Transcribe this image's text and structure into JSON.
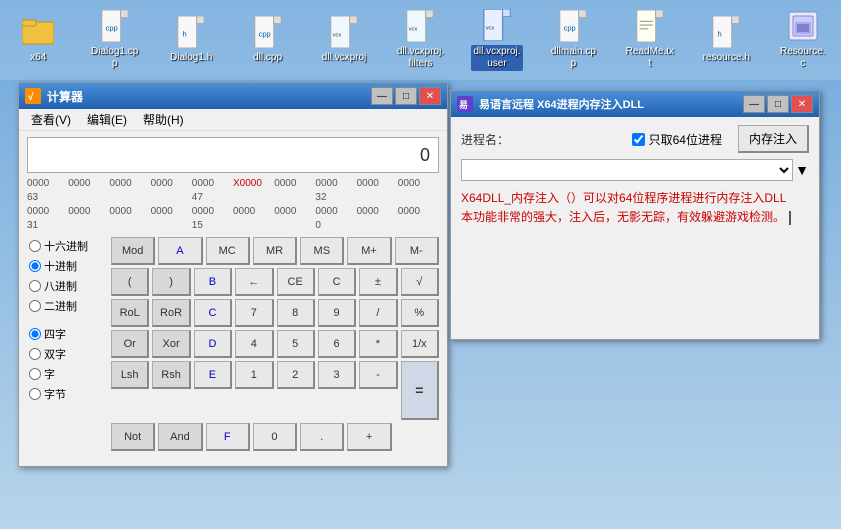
{
  "desktop": {
    "background": "linear-gradient(180deg, #6fa8dc 0%, #b8d4ea 100%)"
  },
  "fileBar": {
    "files": [
      {
        "id": "x64",
        "label": "x64",
        "type": "folder",
        "active": false
      },
      {
        "id": "dialog1cpp",
        "label": "Dialog1.cp\np",
        "type": "cpp",
        "active": false
      },
      {
        "id": "dialog1h",
        "label": "Dialog1.h",
        "type": "h",
        "active": false
      },
      {
        "id": "dllcpp",
        "label": "dll.cpp",
        "type": "cpp",
        "active": false
      },
      {
        "id": "dllvcxproj",
        "label": "dll.vcxproj",
        "type": "vcxproj",
        "active": false
      },
      {
        "id": "dllvcxprojfilters",
        "label": "dll.vcxproj.\nfilters",
        "type": "vcxproj",
        "active": false
      },
      {
        "id": "dllvcxprojuser",
        "label": "dll.vcxproj.\nuser",
        "type": "vcxproj",
        "active": true
      },
      {
        "id": "dllmaincpp",
        "label": "dllmain.cp\np",
        "type": "cpp",
        "active": false
      },
      {
        "id": "readmetxt",
        "label": "ReadMe.tx\nt",
        "type": "txt",
        "active": false
      },
      {
        "id": "resourceh",
        "label": "resource.h",
        "type": "h",
        "active": false
      },
      {
        "id": "resourcerc",
        "label": "Resource.\nc",
        "type": "rc",
        "active": false
      }
    ]
  },
  "calcWindow": {
    "title": "计算器",
    "menuItems": [
      "查看(V)",
      "编辑(E)",
      "帮助(H)"
    ],
    "display": "0",
    "memoryRows": [
      [
        "0000",
        "0000",
        "0000",
        "0000",
        "0000",
        "X0000",
        "0000",
        "0000"
      ],
      [
        "63",
        "",
        "",
        "",
        "47",
        "",
        "",
        "32"
      ],
      [
        "0000",
        "0000",
        "0000",
        "0000",
        "0000",
        "0000",
        "0000",
        "0000"
      ],
      [
        "31",
        "",
        "",
        "",
        "15",
        "",
        "",
        "0"
      ]
    ],
    "radioGroups": {
      "base": [
        {
          "label": "十六进制",
          "value": "hex",
          "checked": false
        },
        {
          "label": "十进制",
          "value": "dec",
          "checked": true
        },
        {
          "label": "八进制",
          "value": "oct",
          "checked": false
        },
        {
          "label": "二进制",
          "value": "bin",
          "checked": false
        }
      ],
      "word": [
        {
          "label": "四字",
          "value": "qword",
          "checked": true
        },
        {
          "label": "双字",
          "value": "dword",
          "checked": false
        },
        {
          "label": "字",
          "value": "word",
          "checked": false
        },
        {
          "label": "字节",
          "value": "byte",
          "checked": false
        }
      ]
    },
    "buttons": [
      [
        "Mod",
        "A",
        "MC",
        "MR",
        "MS",
        "M+",
        "M-"
      ],
      [
        "(",
        ")",
        "B",
        "←",
        "CE",
        "C",
        "±",
        "√"
      ],
      [
        "RoL",
        "RoR",
        "C",
        "7",
        "8",
        "9",
        "/",
        "%"
      ],
      [
        "Or",
        "Xor",
        "D",
        "4",
        "5",
        "6",
        "*",
        "1/x"
      ],
      [
        "Lsh",
        "Rsh",
        "E",
        "1",
        "2",
        "3",
        "-",
        "="
      ],
      [
        "Not",
        "And",
        "F",
        "0",
        ".",
        "+",
        "="
      ]
    ],
    "btnRowsFlat": [
      {
        "label": "Mod",
        "type": "gray"
      },
      {
        "label": "A",
        "type": "blue"
      },
      {
        "label": "MC",
        "type": "normal"
      },
      {
        "label": "MR",
        "type": "normal"
      },
      {
        "label": "MS",
        "type": "normal"
      },
      {
        "label": "M+",
        "type": "normal"
      },
      {
        "label": "M-",
        "type": "normal"
      },
      {
        "label": "(",
        "type": "gray"
      },
      {
        "label": ")",
        "type": "gray"
      },
      {
        "label": "B",
        "type": "blue"
      },
      {
        "label": "←",
        "type": "normal"
      },
      {
        "label": "CE",
        "type": "normal"
      },
      {
        "label": "C",
        "type": "normal"
      },
      {
        "label": "±",
        "type": "normal"
      },
      {
        "label": "√",
        "type": "normal"
      },
      {
        "label": "RoL",
        "type": "gray"
      },
      {
        "label": "RoR",
        "type": "gray"
      },
      {
        "label": "C",
        "type": "blue"
      },
      {
        "label": "7",
        "type": "normal"
      },
      {
        "label": "8",
        "type": "normal"
      },
      {
        "label": "9",
        "type": "normal"
      },
      {
        "label": "/",
        "type": "normal"
      },
      {
        "label": "%",
        "type": "normal"
      },
      {
        "label": "Or",
        "type": "gray"
      },
      {
        "label": "Xor",
        "type": "gray"
      },
      {
        "label": "D",
        "type": "blue"
      },
      {
        "label": "4",
        "type": "normal"
      },
      {
        "label": "5",
        "type": "normal"
      },
      {
        "label": "6",
        "type": "normal"
      },
      {
        "label": "*",
        "type": "normal"
      },
      {
        "label": "1/x",
        "type": "normal"
      },
      {
        "label": "Lsh",
        "type": "gray"
      },
      {
        "label": "Rsh",
        "type": "gray"
      },
      {
        "label": "E",
        "type": "blue"
      },
      {
        "label": "1",
        "type": "normal"
      },
      {
        "label": "2",
        "type": "normal"
      },
      {
        "label": "3",
        "type": "normal"
      },
      {
        "label": "-",
        "type": "normal"
      },
      {
        "label": "=",
        "type": "eq"
      },
      {
        "label": "Not",
        "type": "gray"
      },
      {
        "label": "And",
        "type": "gray"
      },
      {
        "label": "F",
        "type": "blue"
      },
      {
        "label": "0",
        "type": "normal"
      },
      {
        "label": ".",
        "type": "normal"
      },
      {
        "label": "+",
        "type": "normal"
      }
    ]
  },
  "dllWindow": {
    "title": "易语言远程 X64进程内存注入DLL",
    "processLabel": "进程名：",
    "checkboxLabel": "只取64位进程",
    "injectBtn": "内存注入",
    "dropdownPlaceholder": "",
    "infoText": "X64DLL_内存注入（）可以对64位程序进程进行内存注入DLL\n本功能非常的强大，注入后，无影无踪，有效躲避游戏检测。",
    "cursor": "▌"
  },
  "windowControls": {
    "min": "—",
    "max": "□",
    "close": "✕"
  }
}
